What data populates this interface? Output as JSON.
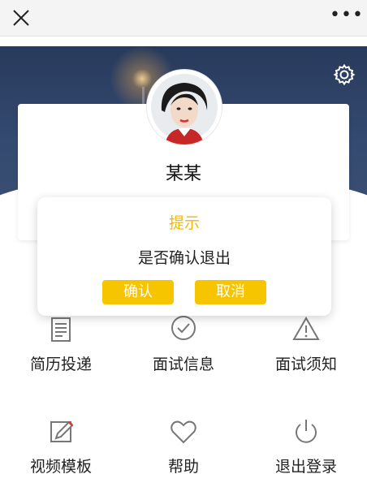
{
  "colors": {
    "accent": "#f7c400",
    "title": "#f3b900",
    "banner": "#2f4468"
  },
  "topbar": {
    "close_icon": "close-icon",
    "more_label": "•••"
  },
  "profile": {
    "name": "某某"
  },
  "menu": [
    {
      "label": "简历投递",
      "icon": "resume-icon"
    },
    {
      "label": "面试信息",
      "icon": "check-circle-icon"
    },
    {
      "label": "面试须知",
      "icon": "warning-icon"
    },
    {
      "label": "视频模板",
      "icon": "edit-icon"
    },
    {
      "label": "帮助",
      "icon": "heart-icon"
    },
    {
      "label": "退出登录",
      "icon": "power-icon"
    }
  ],
  "dialog": {
    "title": "提示",
    "message": "是否确认退出",
    "confirm_label": "确认",
    "cancel_label": "取消"
  }
}
